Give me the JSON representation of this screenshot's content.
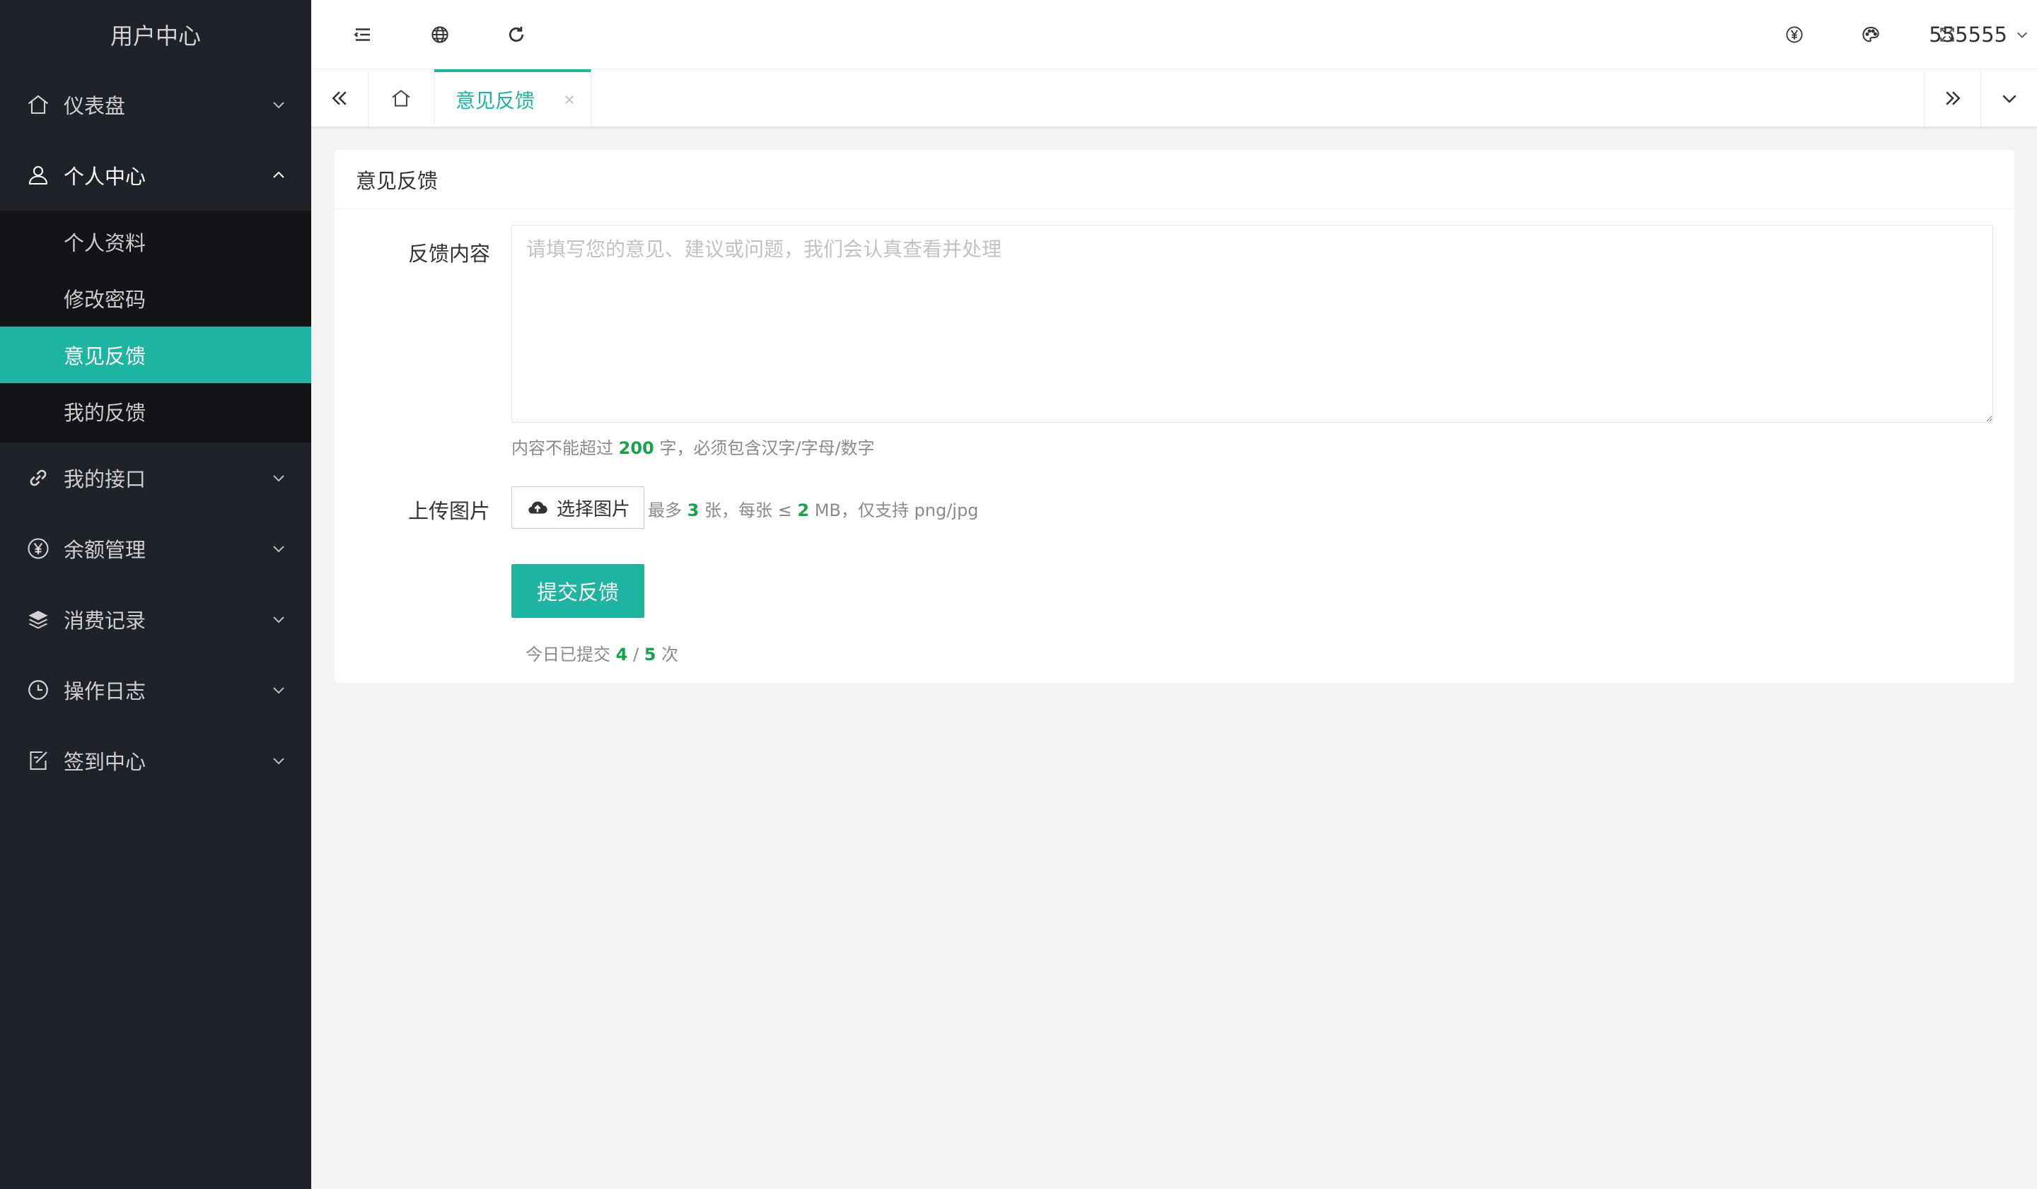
{
  "sidebar": {
    "title": "用户中心",
    "menu": [
      {
        "label": "仪表盘",
        "icon": "home-icon",
        "expanded": false
      },
      {
        "label": "个人中心",
        "icon": "user-icon",
        "expanded": true,
        "children": [
          "个人资料",
          "修改密码",
          "意见反馈",
          "我的反馈"
        ],
        "active_child": "意见反馈"
      },
      {
        "label": "我的接口",
        "icon": "link-icon",
        "expanded": false
      },
      {
        "label": "余额管理",
        "icon": "yen-circle-icon",
        "expanded": false
      },
      {
        "label": "消费记录",
        "icon": "layers-icon",
        "expanded": false
      },
      {
        "label": "操作日志",
        "icon": "clock-icon",
        "expanded": false
      },
      {
        "label": "签到中心",
        "icon": "checkin-edit-icon",
        "expanded": false
      }
    ]
  },
  "header": {
    "left_icons": [
      "menu-collapse-icon",
      "globe-icon",
      "refresh-icon"
    ],
    "right_icons": [
      "yen-circle-icon",
      "palette-icon",
      "fullscreen-icon"
    ],
    "username": "555555"
  },
  "tabs": {
    "active_tab": "意见反馈"
  },
  "card": {
    "title": "意见反馈",
    "content_label": "反馈内容",
    "content_value": "",
    "content_placeholder": "请填写您的意见、建议或问题，我们会认真查看并处理",
    "content_hint_prefix": "内容不能超过",
    "content_max": "200",
    "content_hint_suffix": "字，必须包含汉字/字母/数字",
    "upload_label": "上传图片",
    "upload_button": "选择图片",
    "upload_hint_1": "最多",
    "upload_max_count": "3",
    "upload_hint_2": "张，每张 ≤",
    "upload_max_size": "2",
    "upload_hint_3": "MB，仅支持 png/jpg",
    "submit_button": "提交反馈",
    "today_prefix": "今日已提交",
    "today_count": "4",
    "today_sep": "/",
    "today_limit": "5",
    "today_suffix": "次"
  },
  "colors": {
    "accent": "#1fb3a1",
    "sidebar_bg": "#20222a",
    "submenu_bg": "#131418",
    "highlight_number": "#16a34a"
  }
}
